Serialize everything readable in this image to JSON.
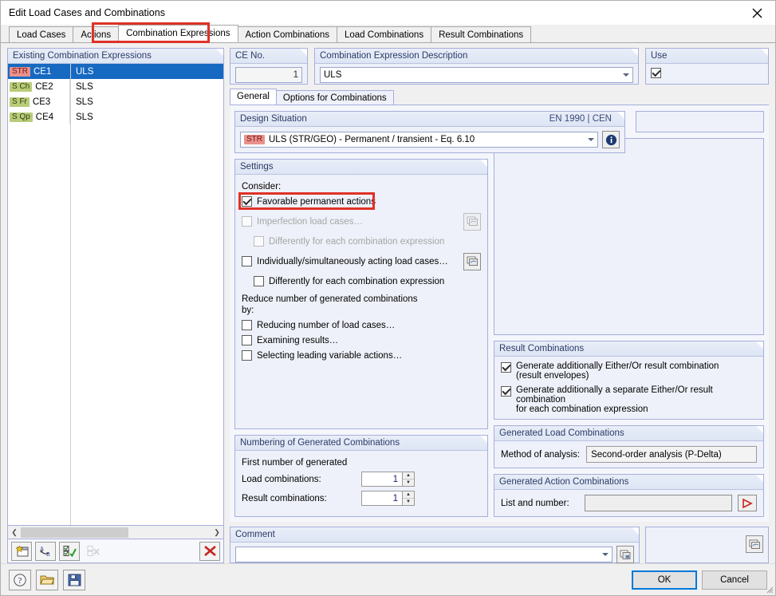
{
  "window": {
    "title": "Edit Load Cases and Combinations",
    "close_icon": "close-icon"
  },
  "tabs": [
    {
      "label": "Load Cases",
      "active": false
    },
    {
      "label": "Actions",
      "active": false
    },
    {
      "label": "Combination Expressions",
      "active": true,
      "highlighted": true
    },
    {
      "label": "Action Combinations",
      "active": false
    },
    {
      "label": "Load Combinations",
      "active": false
    },
    {
      "label": "Result Combinations",
      "active": false
    }
  ],
  "existing": {
    "caption": "Existing Combination Expressions",
    "rows": [
      {
        "badge": "STR",
        "badge_type": "str",
        "no": "CE1",
        "desc": "ULS",
        "selected": true
      },
      {
        "badge": "S Ch",
        "badge_type": "sls",
        "no": "CE2",
        "desc": "SLS",
        "selected": false
      },
      {
        "badge": "S Fr",
        "badge_type": "sls",
        "no": "CE3",
        "desc": "SLS",
        "selected": false
      },
      {
        "badge": "S Qp",
        "badge_type": "sls",
        "no": "CE4",
        "desc": "SLS",
        "selected": false
      }
    ],
    "scroll_left_icon": "chevron-left-icon",
    "scroll_right_icon": "chevron-right-icon",
    "toolbar": [
      {
        "name": "new-combination-expression-button",
        "icon": "new-window-icon",
        "enabled": true
      },
      {
        "name": "rename-button",
        "icon": "rename-ab-icon",
        "enabled": true
      },
      {
        "name": "select-all-button",
        "icon": "checkbox-check-icon",
        "enabled": true
      },
      {
        "name": "deselect-all-button",
        "icon": "checkbox-clear-icon",
        "enabled": false
      },
      {
        "name": "delete-button",
        "icon": "red-x-icon",
        "enabled": true
      }
    ]
  },
  "ce_no": {
    "caption": "CE No.",
    "value": "1"
  },
  "description": {
    "caption": "Combination Expression Description",
    "value": "ULS"
  },
  "use": {
    "caption": "Use",
    "checked": true
  },
  "inner_tabs": [
    {
      "label": "General",
      "active": true
    },
    {
      "label": "Options for Combinations",
      "active": false
    }
  ],
  "design_situation": {
    "caption": "Design Situation",
    "caption_right": "EN 1990 | CEN",
    "badge": "STR",
    "value": "ULS (STR/GEO) - Permanent / transient - Eq. 6.10",
    "info_icon": "info-icon"
  },
  "settings": {
    "caption": "Settings",
    "consider_label": "Consider:",
    "items": [
      {
        "label": "Favorable permanent actions",
        "checked": true,
        "enabled": true,
        "indent": false,
        "highlighted": true,
        "aux_button": false
      },
      {
        "label": "Imperfection load cases…",
        "checked": false,
        "enabled": false,
        "indent": false,
        "highlighted": false,
        "aux_button": true
      },
      {
        "label": "Differently for each combination expression",
        "checked": false,
        "enabled": false,
        "indent": true,
        "highlighted": false,
        "aux_button": false
      },
      {
        "label": "Individually/simultaneously acting load cases…",
        "checked": false,
        "enabled": true,
        "indent": false,
        "highlighted": false,
        "aux_button": true
      },
      {
        "label": "Differently for each combination expression",
        "checked": false,
        "enabled": true,
        "indent": true,
        "highlighted": false,
        "aux_button": false
      }
    ],
    "reduce_label_line1": "Reduce number of generated combinations",
    "reduce_label_line2": "by:",
    "reduce_items": [
      {
        "label": "Reducing number of load cases…",
        "checked": false
      },
      {
        "label": "Examining results…",
        "checked": false
      },
      {
        "label": "Selecting leading variable actions…",
        "checked": false
      }
    ]
  },
  "numbering": {
    "caption": "Numbering of Generated Combinations",
    "intro": "First number of generated",
    "rows": [
      {
        "label": "Load combinations:",
        "value": "1"
      },
      {
        "label": "Result combinations:",
        "value": "1"
      }
    ]
  },
  "result_combinations": {
    "caption": "Result Combinations",
    "items": [
      {
        "line1": "Generate additionally Either/Or result combination",
        "line2": "(result envelopes)",
        "checked": true
      },
      {
        "line1": "Generate additionally a separate Either/Or result combination",
        "line2": "for each combination expression",
        "checked": true
      }
    ]
  },
  "generated_load_combinations": {
    "caption": "Generated Load Combinations",
    "method_label": "Method of analysis:",
    "method_value": "Second-order analysis (P-Delta)"
  },
  "generated_action_combinations": {
    "caption": "Generated Action Combinations",
    "list_label": "List and number:",
    "list_value": "",
    "go_icon": "arrow-right-icon"
  },
  "comment": {
    "caption": "Comment",
    "value": "",
    "picker_icon": "copy-windows-icon",
    "right_icon": "layers-icon"
  },
  "footer": {
    "help_icon": "help-icon",
    "open_icon": "folder-open-icon",
    "save_icon": "floppy-save-icon",
    "ok_label": "OK",
    "cancel_label": "Cancel"
  },
  "colors": {
    "accent_blue": "#1669c1",
    "highlight_red": "#e03127",
    "badge_str": "#e8918c",
    "badge_sls": "#b9cc7a",
    "group_border": "#a7aedb",
    "group_bg": "#eef1f9"
  }
}
